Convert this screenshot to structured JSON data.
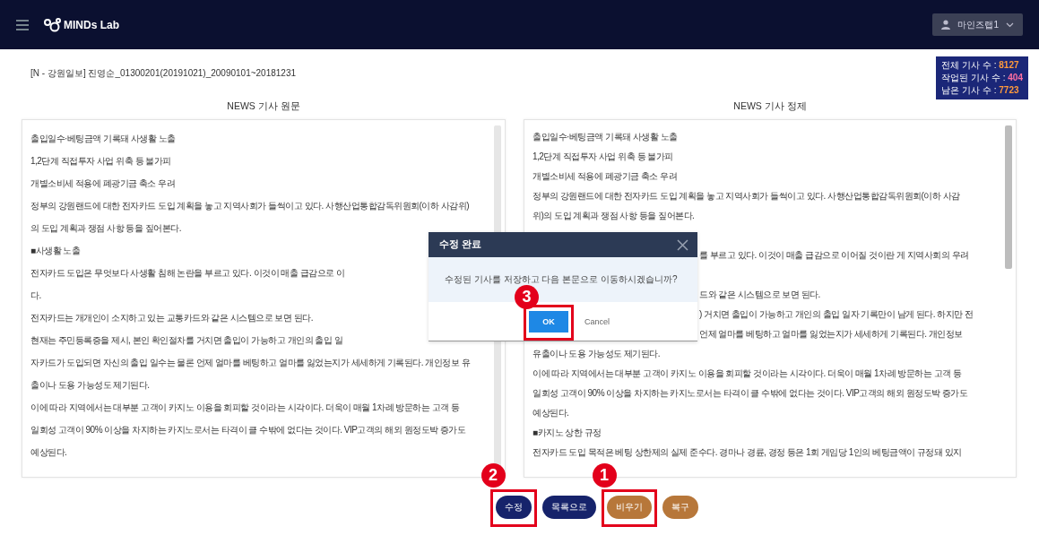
{
  "header": {
    "logo": "MINDs Lab",
    "user": "마인즈랩1"
  },
  "title": "[N - 강원일보] 진영순_01300201(20191021)_20090101~20181231",
  "stats": [
    {
      "label": "전체 기사 수 :",
      "value": "8127",
      "color": "#ff9a3c"
    },
    {
      "label": "작업된 기사 수 :",
      "value": "404",
      "color": "#ff6fa0"
    },
    {
      "label": "남은 기사 수 :",
      "value": "7723",
      "color": "#ff9a3c"
    }
  ],
  "panels": [
    {
      "heading": "NEWS 기사 원문",
      "lines": [
        {
          "kind": "text",
          "text": "출입일수·베팅금액 기록돼 사생활 노출"
        },
        {
          "kind": "text",
          "text": "1,2단계 직접투자 사업 위축 등 불가피"
        },
        {
          "kind": "text",
          "text": "개별소비세 적용에 폐광기금 축소 우려"
        },
        {
          "kind": "text",
          "text": "정부의 강원랜드에 대한 전자카드 도입 계획을 놓고 지역사회가 들썩이고 있다. 사행산업통합감독위원회(이하 사감위)"
        },
        {
          "kind": "text",
          "text": "의 도입 계획과 쟁점 사항 등을 짚어본다."
        },
        {
          "kind": "text",
          "text": "■사생활 노출"
        },
        {
          "kind": "text",
          "text": "전자카드 도입은 무엇보다 사생활 침해 논란을 부르고 있다. 이것이 매출 급감으로 이"
        },
        {
          "kind": "text",
          "text": "다."
        },
        {
          "kind": "text",
          "text": "전자카드는 개개인이 소지하고 있는 교통카드와 같은 시스템으로 보면 된다."
        },
        {
          "kind": "text",
          "text": "현재는 주민등록증을 제시, 본인 확인절차를 거치면 출입이 가능하고 개인의 출입 일"
        },
        {
          "kind": "text",
          "text": "자카드가 도입되면 자신의 출입 일수는 물론 언제 얼마를 베팅하고 얼마를 잃었는지가 세세하게 기록된다. 개인정보 유"
        },
        {
          "kind": "text",
          "text": "출이나 도용 가능성도 제기된다."
        },
        {
          "kind": "text",
          "text": "이에 따라 지역에서는 대부분 고객이 카지노 이용을 회피할 것이라는 시각이다. 더욱이 매월 1차례 방문하는 고객 등"
        },
        {
          "kind": "text",
          "text": "일회성 고객이 90% 이상을 차지하는 카지노로서는 타격이 클 수밖에 없다는 것이다. VIP고객의 해외 원정도박 증가도"
        },
        {
          "kind": "text",
          "text": "예상된다."
        }
      ]
    },
    {
      "heading": "NEWS 기사 정제",
      "lines": [
        {
          "kind": "text",
          "text": "출입일수·베팅금액 기록돼 사생활 노출"
        },
        {
          "kind": "text",
          "text": "1,2단계 직접투자 사업 위축 등 불가피"
        },
        {
          "kind": "text",
          "text": "개별소비세 적용에 폐광기금 축소 우려"
        },
        {
          "kind": "text",
          "text": "정부의 강원랜드에 대한 전자카드 도입 계획을 놓고 지역사회가 들썩이고 있다. 사행산업통합감독위원회(이하 사감"
        },
        {
          "kind": "text",
          "text": "위)의 도입 계획과 쟁점 사항 등을 짚어본다."
        },
        {
          "kind": "covered"
        },
        {
          "kind": "partial",
          "text": "를 부르고 있다. 이것이 매출 급감으로 이어질 것이란 게 지역사회의 우려"
        },
        {
          "kind": "covered"
        },
        {
          "kind": "partial",
          "text": "드와 같은 시스템으로 보면 된다."
        },
        {
          "kind": "partial",
          "text": ") 거치면 출입이 가능하고 개인의 출입 일자 기록만이 남게 된다. 하지만 전"
        },
        {
          "kind": "partial",
          "text": "언제 얼마를 베팅하고 얼마를 잃었는지가 세세하게 기록된다. 개인정보"
        },
        {
          "kind": "text",
          "text": "유출이나 도용 가능성도 제기된다."
        },
        {
          "kind": "text",
          "text": "이에 따라 지역에서는 대부분 고객이 카지노 이용을 회피할 것이라는 시각이다. 더욱이 매월 1차례 방문하는 고객 등"
        },
        {
          "kind": "text",
          "text": "일회성 고객이 90% 이상을 차지하는 카지노로서는 타격이 클 수밖에 없다는 것이다. VIP고객의 해외 원정도박 증가도"
        },
        {
          "kind": "text",
          "text": "예상된다."
        },
        {
          "kind": "text",
          "text": "■카지노 상한 규정"
        },
        {
          "kind": "text",
          "text": "전자카드 도입 목적은 베팅 상한제의 실제 준수다. 경마나 경륜, 경정 등은 1회 게임당 1인의 베팅금액이 규정돼 있지"
        }
      ]
    }
  ],
  "actions": [
    {
      "label": "수정",
      "color": "#16236b",
      "annotation": "2"
    },
    {
      "label": "목록으로",
      "color": "#16236b"
    },
    {
      "label": "비우기",
      "color": "#b7773a",
      "annotation": "1"
    },
    {
      "label": "복구",
      "color": "#b7773a"
    }
  ],
  "dialog": {
    "title": "수정 완료",
    "message": "수정된 기사를 저장하고 다음 본문으로 이동하시겠습니까?",
    "buttons": [
      {
        "label": "OK",
        "kind": "primary",
        "annotation": "3"
      },
      {
        "label": "Cancel",
        "kind": "secondary"
      }
    ]
  }
}
